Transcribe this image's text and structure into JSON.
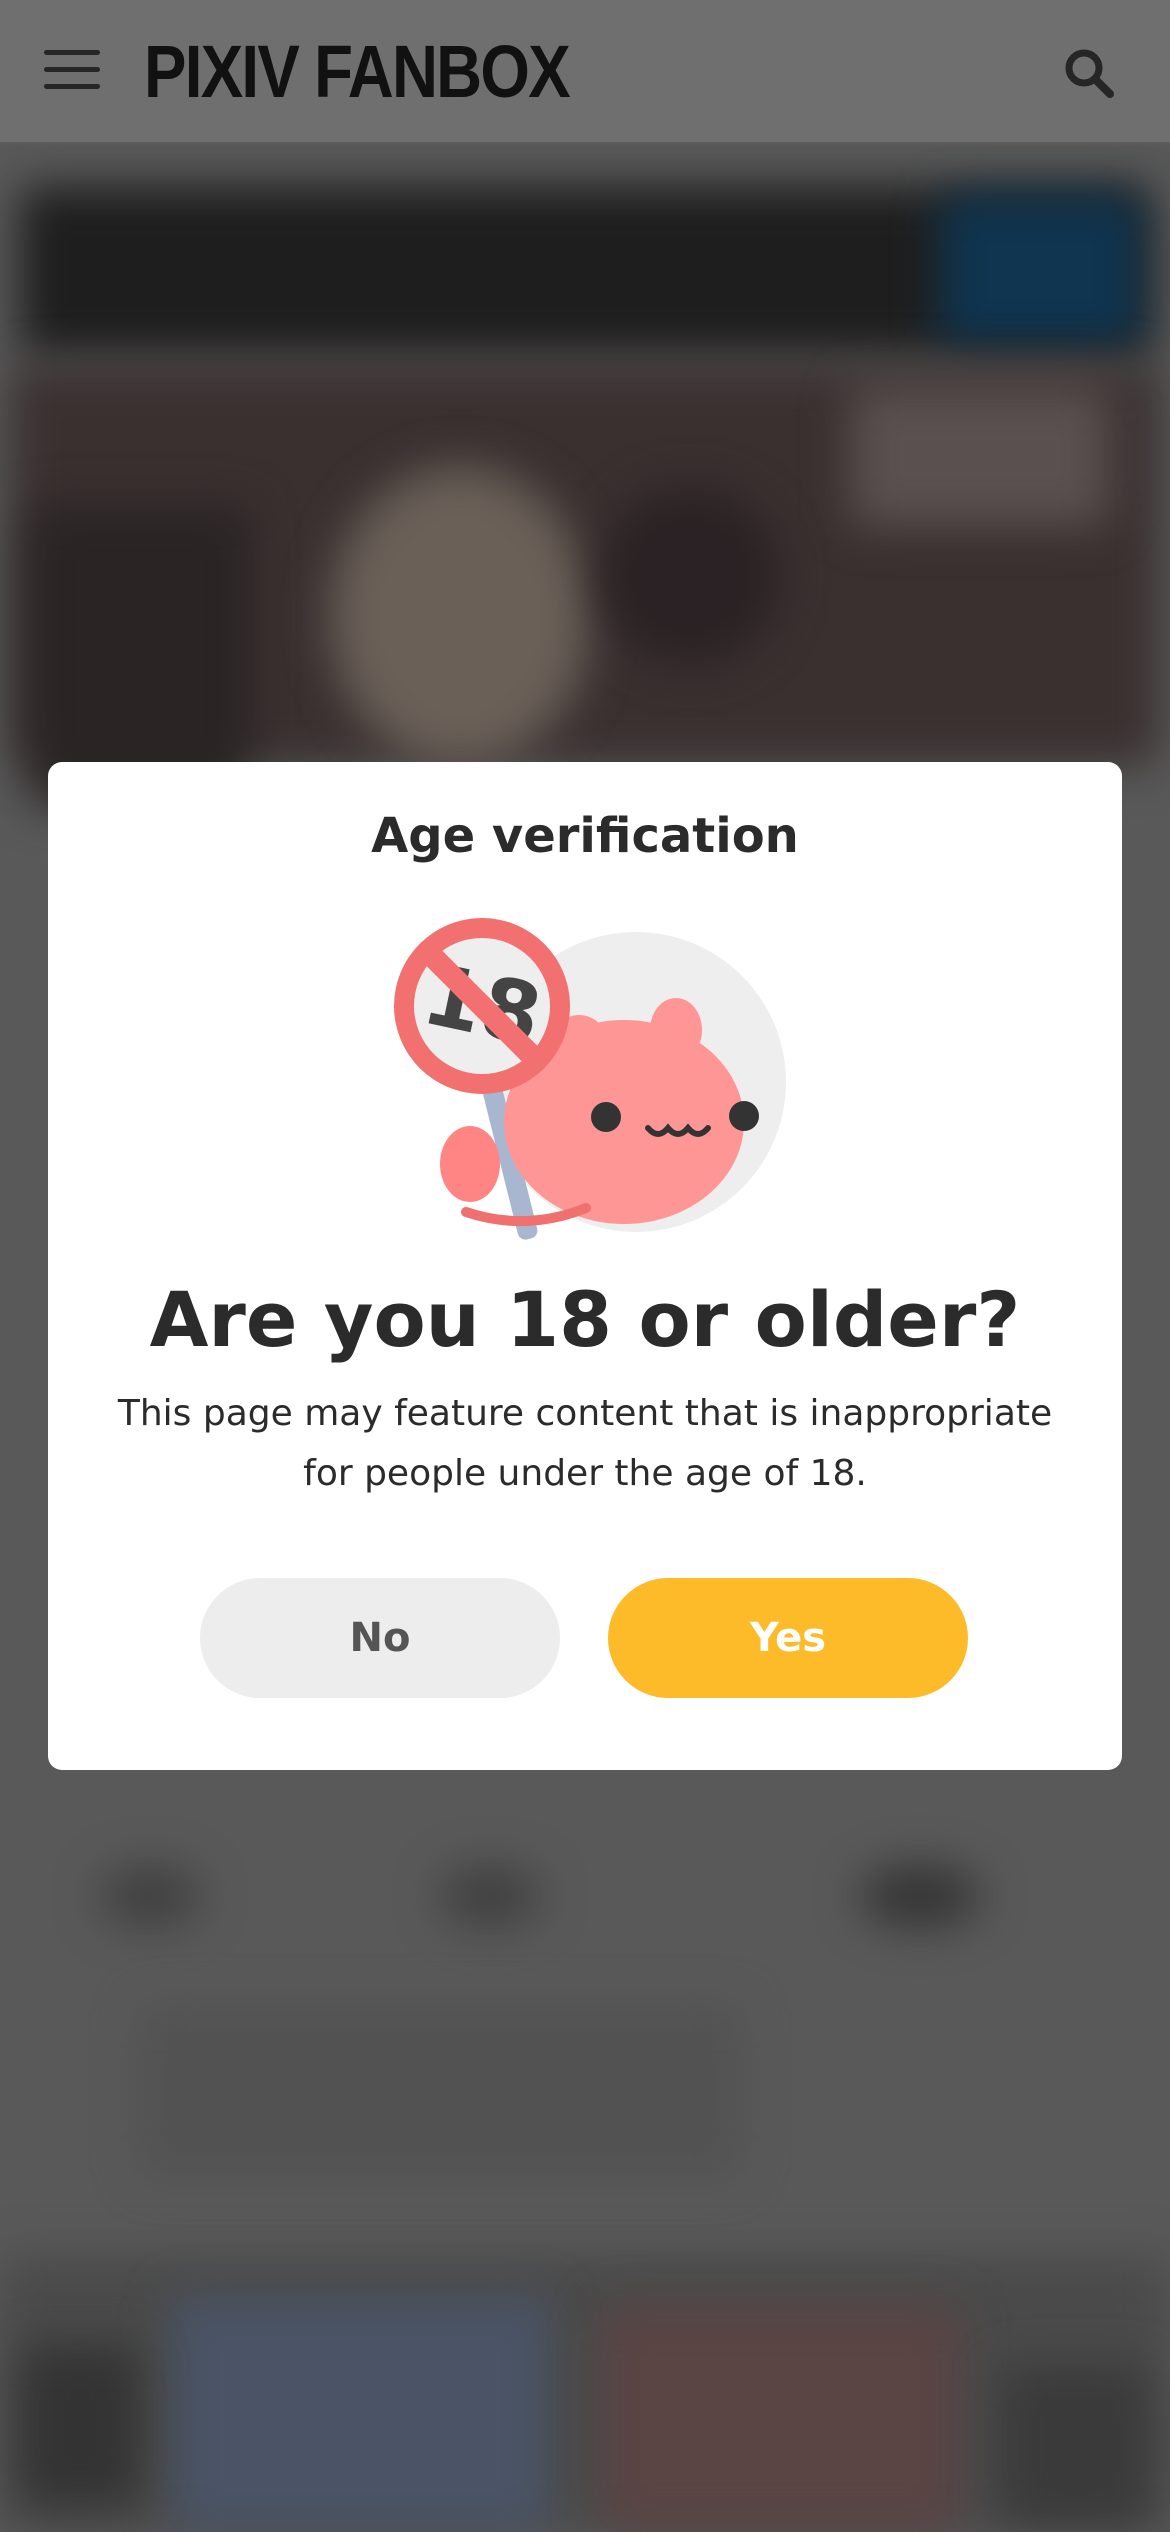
{
  "header": {
    "logo_text": "PIXIV FANBOX",
    "menu_icon": "hamburger-menu-icon",
    "search_icon": "search-icon"
  },
  "modal": {
    "title": "Age verification",
    "illustration": "pink-creature-holding-no-18-sign",
    "question": "Are you 18 or older?",
    "description": "This page may feature content that is inappropriate for people under the age of 18.",
    "no_label": "No",
    "yes_label": "Yes"
  },
  "colors": {
    "overlay": "#595959",
    "header": "#6f6f6f",
    "modal_bg": "#ffffff",
    "yes_button": "#fdbb2a",
    "no_button": "#ededed",
    "text": "#2b2b2b"
  }
}
